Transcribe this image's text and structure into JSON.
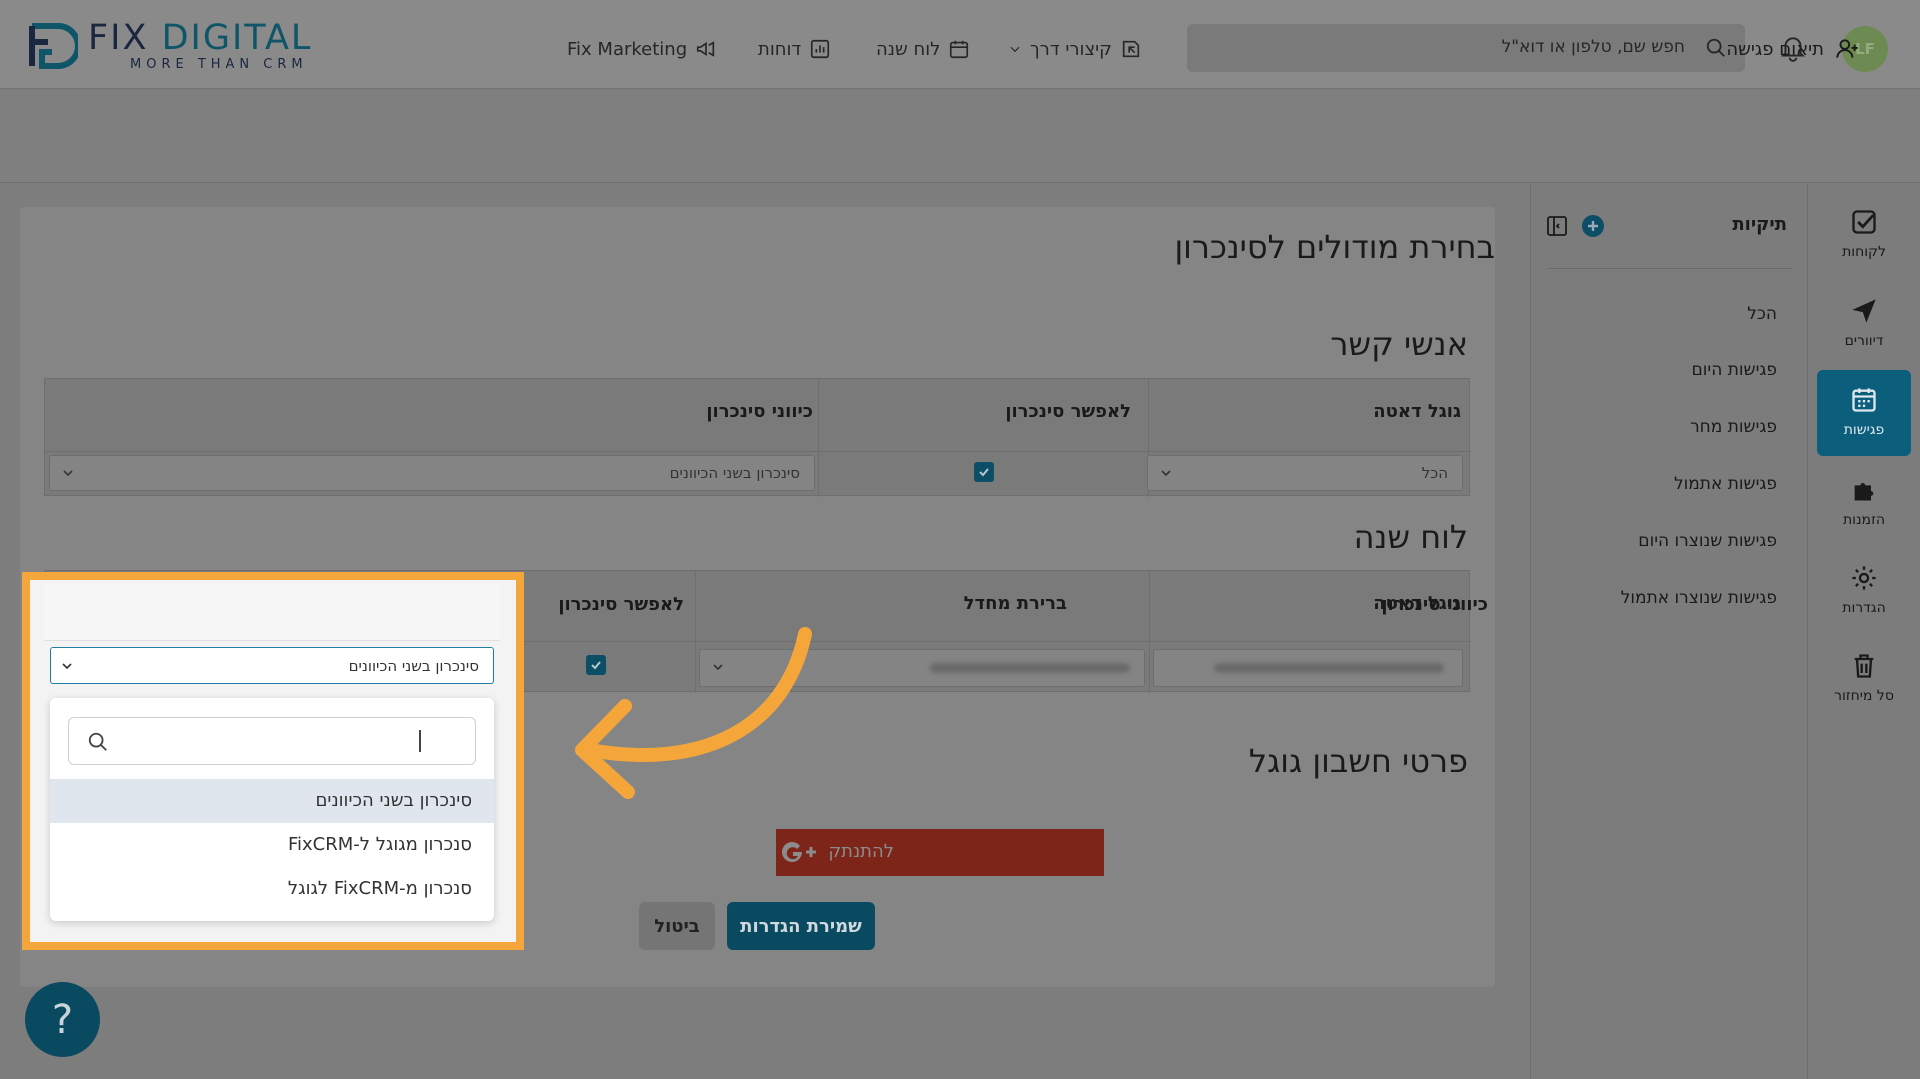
{
  "header": {
    "logo_main_a": "FIX",
    "logo_main_b": "DIGITAL",
    "logo_sub": "MORE THAN CRM",
    "nav": [
      {
        "label": "Fix Marketing",
        "icon": "megaphone-icon"
      },
      {
        "label": "דוחות",
        "icon": "report-icon"
      },
      {
        "label": "לוח שנה",
        "icon": "calendar-icon"
      },
      {
        "label": "קיצורי דרך",
        "icon": "shortcut-icon"
      }
    ],
    "search_placeholder": "חפש שם, טלפון או דוא\"ל",
    "avatar_initials": "LF"
  },
  "subheader": {
    "action_label": "תיאום פגישה"
  },
  "rail": {
    "items": [
      {
        "label": "לקוחות",
        "icon": "checkbox-icon"
      },
      {
        "label": "דיוורים",
        "icon": "send-icon"
      },
      {
        "label": "פגישות",
        "icon": "calendar-icon",
        "active": true
      },
      {
        "label": "הזמנות",
        "icon": "puzzle-icon"
      },
      {
        "label": "הגדרות",
        "icon": "gear-icon"
      },
      {
        "label": "סל מיחזור",
        "icon": "trash-icon"
      }
    ]
  },
  "folders": {
    "title": "תיקיות",
    "items": [
      "הכל",
      "פגישות היום",
      "פגישות מחר",
      "פגישות אתמול",
      "פגישות שנוצרו היום",
      "פגישות שנוצרו אתמול"
    ]
  },
  "main": {
    "title": "בחירת מודולים לסינכרון",
    "contacts": {
      "heading": "אנשי קשר",
      "col_google": "גוגל דאטה",
      "col_enable": "לאפשר סינכרון",
      "col_direction": "כיווני סינכרון",
      "google_value": "הכל",
      "direction_value": "סינכרון בשני הכיוונים"
    },
    "calendar": {
      "heading": "לוח שנה",
      "col_google": "גוגל דאטה",
      "col_default": "ברירת מחדל",
      "col_enable": "לאפשר סינכרון",
      "col_direction": "כיווני סינכרון",
      "direction_value": "סינכרון בשני הכיוונים"
    },
    "google_account": {
      "heading": "פרטי חשבון גוגל",
      "connect_label": "להתנתק"
    },
    "save_label": "שמירת הגדרות",
    "cancel_label": "ביטול"
  },
  "dropdown": {
    "options": [
      "סינכרון בשני הכיוונים",
      "סנכרון מגוגל ל-FixCRM",
      "סנכרון מ-FixCRM לגוגל"
    ],
    "selected_index": 0
  },
  "help_label": "?",
  "colors": {
    "accent": "#0b5f7d",
    "highlight": "#f5a63a",
    "google_red": "#c0392b"
  }
}
